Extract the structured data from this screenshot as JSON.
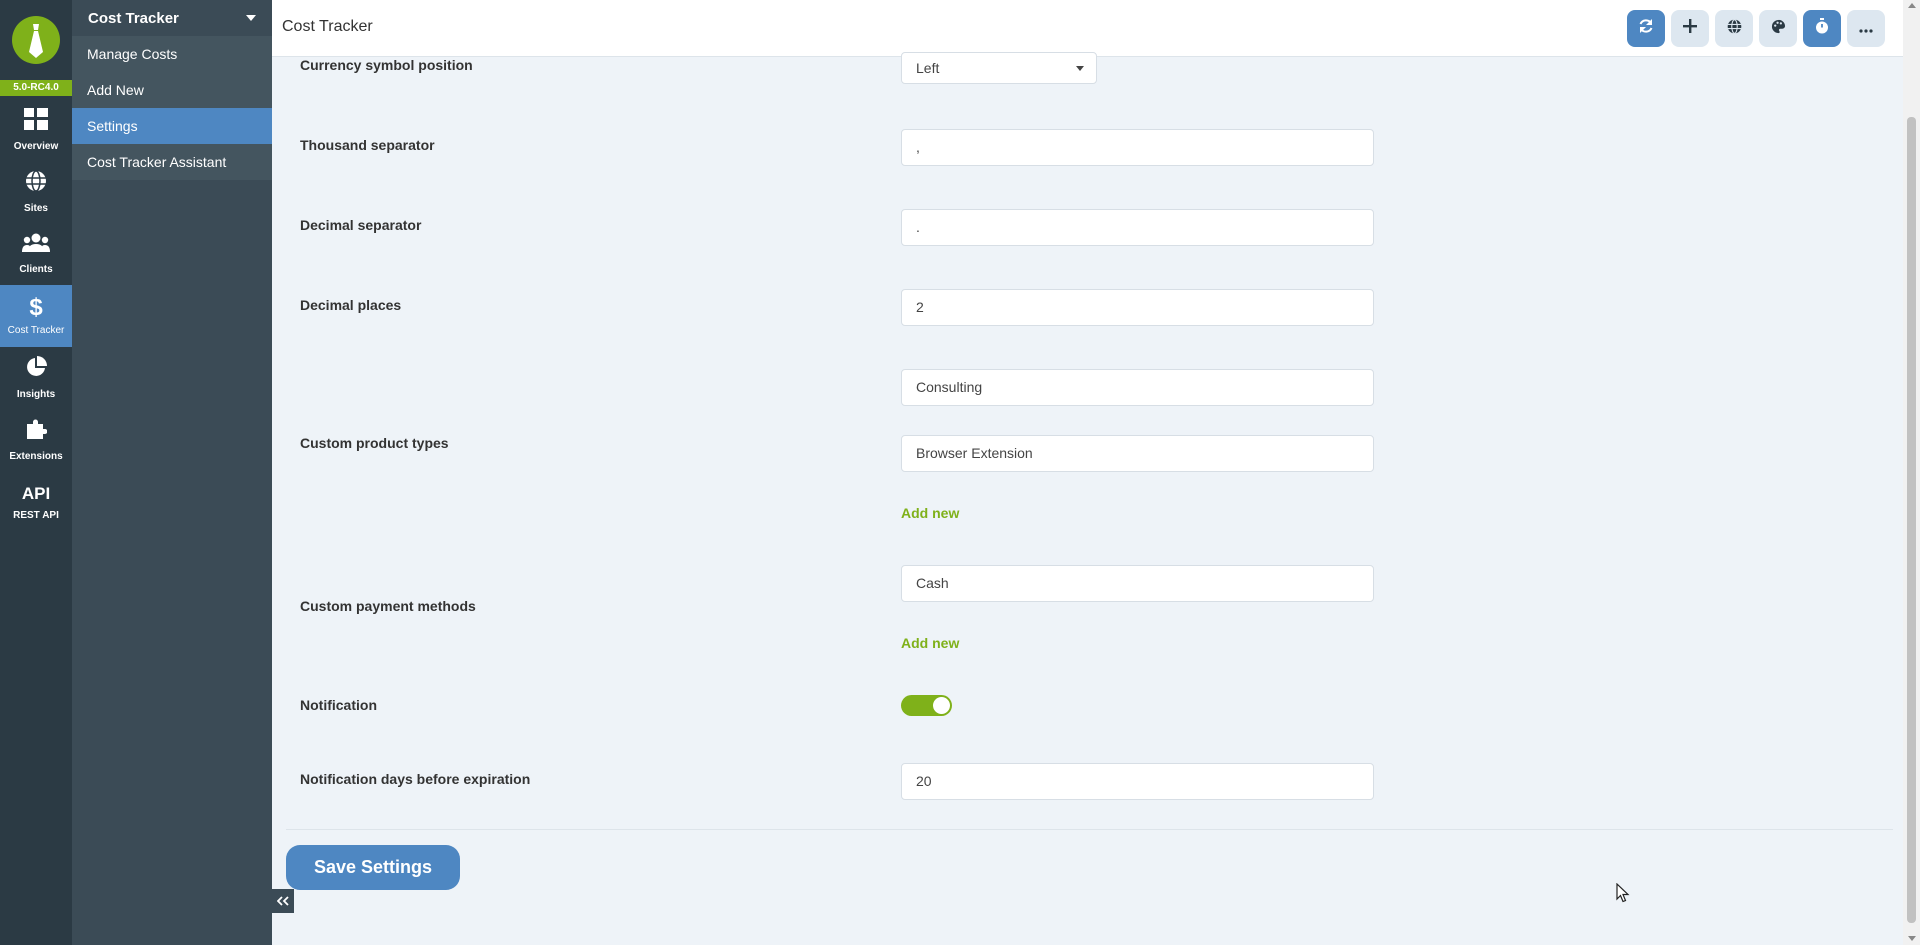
{
  "app": {
    "version": "5.0-RC4.0"
  },
  "rail": {
    "items": [
      {
        "label": "Overview",
        "icon": "grid-icon"
      },
      {
        "label": "Sites",
        "icon": "globe-icon"
      },
      {
        "label": "Clients",
        "icon": "users-icon"
      },
      {
        "label": "Cost Tracker",
        "icon": "dollar-icon",
        "active": true
      },
      {
        "label": "Insights",
        "icon": "pie-chart-icon"
      },
      {
        "label": "Extensions",
        "icon": "puzzle-icon"
      },
      {
        "label": "REST API",
        "icon_text": "API"
      }
    ]
  },
  "subnav": {
    "title": "Cost Tracker",
    "items": [
      {
        "label": "Manage Costs"
      },
      {
        "label": "Add New"
      },
      {
        "label": "Settings",
        "active": true
      },
      {
        "label": "Cost Tracker Assistant"
      }
    ]
  },
  "header": {
    "title": "Cost Tracker",
    "buttons": [
      "sync-icon",
      "plus-icon",
      "globe-icon",
      "palette-icon",
      "timer-icon",
      "more-icon"
    ]
  },
  "settings": {
    "currency_position": {
      "label": "Currency symbol position",
      "value": "Left"
    },
    "thousand_separator": {
      "label": "Thousand separator",
      "value": ","
    },
    "decimal_separator": {
      "label": "Decimal separator",
      "value": "."
    },
    "decimal_places": {
      "label": "Decimal places",
      "value": "2"
    },
    "product_types": {
      "label": "Custom product types",
      "values": [
        "Consulting",
        "Browser Extension"
      ],
      "add_label": "Add new"
    },
    "payment_methods": {
      "label": "Custom payment methods",
      "values": [
        "Cash"
      ],
      "add_label": "Add new"
    },
    "notification": {
      "label": "Notification",
      "enabled": true
    },
    "notification_days": {
      "label": "Notification days before expiration",
      "value": "20"
    },
    "save_label": "Save Settings"
  },
  "colors": {
    "accent_green": "#7fb11a",
    "accent_blue": "#4e87c2",
    "rail_bg": "#2b3a44",
    "subnav_bg": "#3b4b56"
  }
}
